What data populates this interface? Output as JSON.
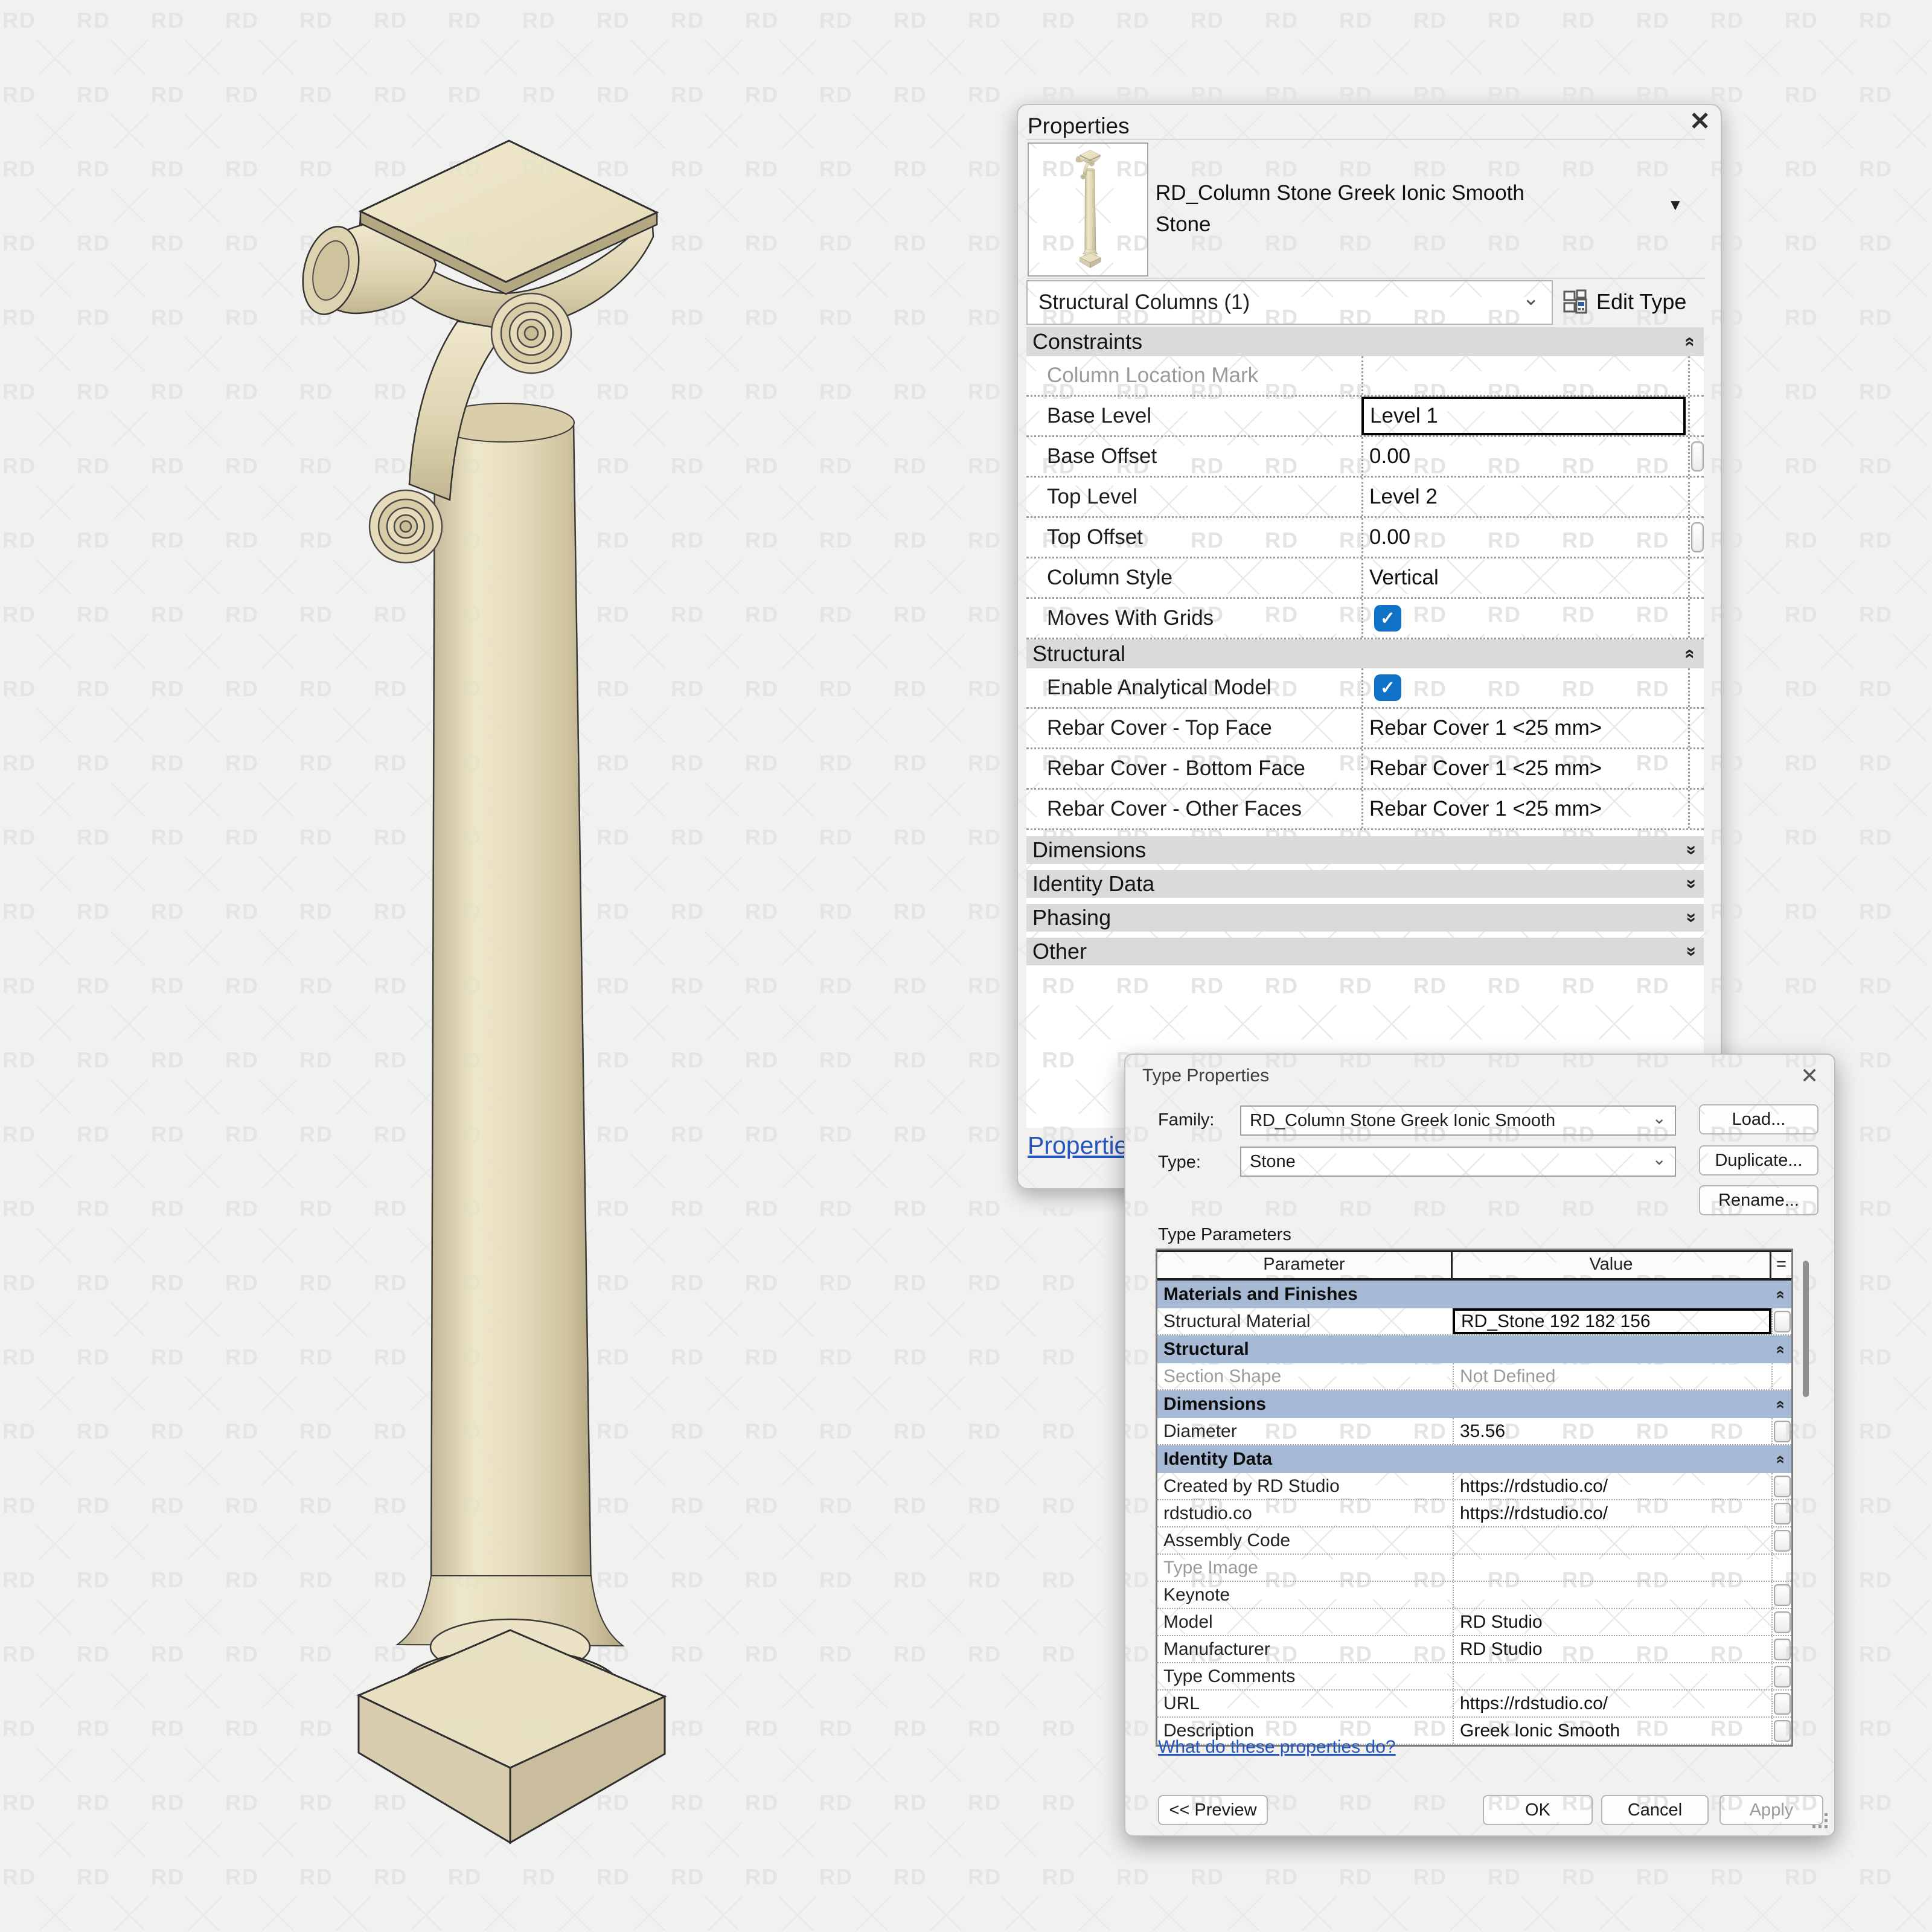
{
  "watermark": {
    "text": "RD"
  },
  "icons": {
    "close": "✕",
    "combo_chevron": "⌄",
    "type_caret": "▼",
    "double_chevron": "«",
    "check": "✓"
  },
  "colors": {
    "accent_blue": "#1072c6",
    "table_section_header": "#a6bad6",
    "link_blue": "#2456c0",
    "stone_light": "#efe6c9",
    "stone_dark": "#b9ac89"
  },
  "properties_panel": {
    "title": "Properties",
    "type_name": "RD_Column Stone Greek Ionic Smooth Stone",
    "selector_value": "Structural Columns (1)",
    "edit_type_label": "Edit Type",
    "bottom_link": "Propertie",
    "groups": [
      {
        "label": "Constraints",
        "state": "expanded",
        "rows": [
          {
            "label": "Column Location Mark",
            "value": "",
            "style": "disabled",
            "assoc": false
          },
          {
            "label": "Base Level",
            "value": "Level 1",
            "style": "selected",
            "assoc": false
          },
          {
            "label": "Base Offset",
            "value": "0.00",
            "style": "normal",
            "assoc": true
          },
          {
            "label": "Top Level",
            "value": "Level 2",
            "style": "normal",
            "assoc": false
          },
          {
            "label": "Top Offset",
            "value": "0.00",
            "style": "normal",
            "assoc": true
          },
          {
            "label": "Column Style",
            "value": "Vertical",
            "style": "normal",
            "assoc": false
          },
          {
            "label": "Moves With Grids",
            "checkbox": true,
            "checked": true,
            "style": "normal",
            "assoc": false
          }
        ]
      },
      {
        "label": "Structural",
        "state": "expanded",
        "rows": [
          {
            "label": "Enable Analytical Model",
            "checkbox": true,
            "checked": true,
            "style": "normal",
            "assoc": false
          },
          {
            "label": "Rebar Cover - Top Face",
            "value": "Rebar Cover 1 <25 mm>",
            "style": "normal",
            "assoc": false
          },
          {
            "label": "Rebar Cover - Bottom Face",
            "value": "Rebar Cover 1 <25 mm>",
            "style": "normal",
            "assoc": false
          },
          {
            "label": "Rebar Cover - Other Faces",
            "value": "Rebar Cover 1 <25 mm>",
            "style": "normal",
            "assoc": false
          }
        ]
      },
      {
        "label": "Dimensions",
        "state": "collapsed",
        "rows": []
      },
      {
        "label": "Identity Data",
        "state": "collapsed",
        "rows": []
      },
      {
        "label": "Phasing",
        "state": "collapsed",
        "rows": []
      },
      {
        "label": "Other",
        "state": "collapsed",
        "rows": []
      }
    ]
  },
  "type_properties_dialog": {
    "title": "Type Properties",
    "family_label": "Family:",
    "family_value": "RD_Column Stone Greek Ionic Smooth",
    "type_label": "Type:",
    "type_value": "Stone",
    "load_button": "Load...",
    "duplicate_button": "Duplicate...",
    "rename_button": "Rename...",
    "type_parameters_label": "Type Parameters",
    "table": {
      "headers": {
        "parameter": "Parameter",
        "value": "Value",
        "assoc": "="
      },
      "sections": [
        {
          "label": "Materials and Finishes",
          "rows": [
            {
              "parameter": "Structural Material",
              "value": "RD_Stone 192 182 156",
              "style": "selected",
              "assoc": true
            }
          ]
        },
        {
          "label": "Structural",
          "rows": [
            {
              "parameter": "Section Shape",
              "value": "Not Defined",
              "style": "disabled",
              "assoc": false
            }
          ]
        },
        {
          "label": "Dimensions",
          "rows": [
            {
              "parameter": "Diameter",
              "value": "35.56",
              "style": "normal",
              "assoc": true
            }
          ]
        },
        {
          "label": "Identity Data",
          "rows": [
            {
              "parameter": "Created by RD Studio",
              "value": "https://rdstudio.co/",
              "style": "normal",
              "assoc": true
            },
            {
              "parameter": "rdstudio.co",
              "value": "https://rdstudio.co/",
              "style": "normal",
              "assoc": true
            },
            {
              "parameter": "Assembly Code",
              "value": "",
              "style": "normal",
              "assoc": true
            },
            {
              "parameter": "Type Image",
              "value": "",
              "style": "disabled",
              "assoc": false
            },
            {
              "parameter": "Keynote",
              "value": "",
              "style": "normal",
              "assoc": true
            },
            {
              "parameter": "Model",
              "value": "RD Studio",
              "style": "normal",
              "assoc": true
            },
            {
              "parameter": "Manufacturer",
              "value": "RD Studio",
              "style": "normal",
              "assoc": true
            },
            {
              "parameter": "Type Comments",
              "value": "",
              "style": "normal",
              "assoc": true
            },
            {
              "parameter": "URL",
              "value": "https://rdstudio.co/",
              "style": "normal",
              "assoc": true
            },
            {
              "parameter": "Description",
              "value": "Greek Ionic Smooth",
              "style": "normal",
              "assoc": true
            }
          ]
        }
      ]
    },
    "help_link": "What do these properties do?",
    "preview_button": "<< Preview",
    "ok_button": "OK",
    "cancel_button": "Cancel",
    "apply_button": "Apply"
  }
}
